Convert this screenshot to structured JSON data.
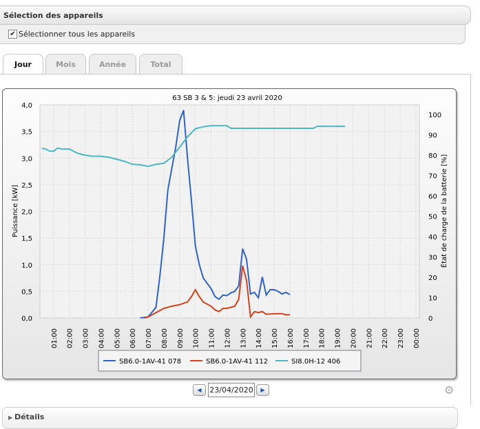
{
  "selection": {
    "title": "Sélection des appareils",
    "select_all_label": "Sélectionner tous les appareils",
    "select_all_checked": true
  },
  "tabs": [
    {
      "label": "Jour",
      "active": true
    },
    {
      "label": "Mois",
      "active": false
    },
    {
      "label": "Année",
      "active": false
    },
    {
      "label": "Total",
      "active": false
    }
  ],
  "date_nav": {
    "date": "23/04/2020",
    "prev": "◀",
    "next": "▶"
  },
  "details_label": "Détails",
  "chart_data": {
    "type": "line",
    "title": "63 SB 3 & 5: jeudi 23 avril 2020",
    "ylabel": "Puissance [kW]",
    "ylabel_right": "État de charge de la batterie [%]",
    "ylim": [
      0,
      4
    ],
    "ylim_right": [
      0,
      100
    ],
    "yticks": [
      "0,0",
      "0,5",
      "1,0",
      "1,5",
      "2,0",
      "2,5",
      "3,0",
      "3,5",
      "4,0"
    ],
    "yticks_right": [
      "0",
      "10",
      "20",
      "30",
      "40",
      "50",
      "60",
      "70",
      "80",
      "90",
      "100"
    ],
    "xticks": [
      "01:00",
      "02:00",
      "03:00",
      "04:00",
      "05:00",
      "06:00",
      "07:00",
      "08:00",
      "09:00",
      "10:00",
      "11:00",
      "12:00",
      "13:00",
      "14:00",
      "15:00",
      "16:00",
      "17:00",
      "18:00",
      "19:00",
      "20:00",
      "21:00",
      "22:00",
      "23:00",
      "00:00"
    ],
    "grid": true,
    "legend_position": "bottom",
    "series": [
      {
        "name": "SB6.0-1AV-41 078",
        "color": "#2f62c8",
        "axis": "left",
        "x": [
          6.5,
          7,
          7.5,
          7.75,
          8,
          8.25,
          8.5,
          8.75,
          9,
          9.25,
          9.5,
          9.75,
          10,
          10.25,
          10.5,
          10.75,
          11,
          11.25,
          11.5,
          11.75,
          12,
          12.25,
          12.5,
          12.75,
          13,
          13.25,
          13.5,
          13.75,
          14,
          14.25,
          14.5,
          14.75,
          15,
          15.25,
          15.5,
          15.75,
          16
        ],
        "y": [
          0,
          0.02,
          0.2,
          0.8,
          1.5,
          2.4,
          2.8,
          3.2,
          3.7,
          3.9,
          3.0,
          2.2,
          1.35,
          1.0,
          0.75,
          0.65,
          0.55,
          0.4,
          0.35,
          0.43,
          0.42,
          0.47,
          0.5,
          0.6,
          1.3,
          1.1,
          0.45,
          0.48,
          0.38,
          0.77,
          0.43,
          0.53,
          0.53,
          0.5,
          0.45,
          0.48,
          0.44
        ]
      },
      {
        "name": "SB6.0-1AV-41 112",
        "color": "#d5401a",
        "axis": "left",
        "x": [
          6.75,
          7,
          7.5,
          8,
          8.5,
          9,
          9.5,
          9.75,
          10,
          10.25,
          10.5,
          11,
          11.25,
          11.5,
          11.75,
          12,
          12.5,
          12.75,
          13,
          13.25,
          13.5,
          13.75,
          14,
          14.25,
          14.5,
          15,
          15.5,
          15.75,
          16
        ],
        "y": [
          0,
          0.02,
          0.1,
          0.18,
          0.22,
          0.25,
          0.3,
          0.4,
          0.53,
          0.4,
          0.3,
          0.22,
          0.15,
          0.12,
          0.18,
          0.18,
          0.22,
          0.35,
          0.98,
          0.7,
          0.02,
          0.12,
          0.1,
          0.12,
          0.07,
          0.08,
          0.08,
          0.06,
          0.06
        ]
      },
      {
        "name": "SI8.0H-12 406",
        "color": "#4ab8c4",
        "axis": "right",
        "x": [
          0.25,
          0.5,
          0.75,
          1,
          1.25,
          1.5,
          2,
          2.5,
          3,
          3.5,
          4,
          4.5,
          5,
          5.5,
          6,
          6.5,
          7,
          7.5,
          8,
          8.5,
          9,
          9.5,
          10,
          10.5,
          11,
          12,
          12.25,
          13,
          17.5,
          17.75,
          19.5
        ],
        "y": [
          83.4,
          83,
          82,
          82,
          83.5,
          83,
          83,
          81,
          80,
          79.5,
          79.5,
          79,
          78,
          77,
          75.5,
          75.3,
          74.5,
          75.5,
          76,
          79,
          84,
          89,
          93,
          94,
          94.5,
          94.5,
          93.2,
          93.2,
          93.2,
          94.2,
          94.2
        ]
      }
    ]
  }
}
